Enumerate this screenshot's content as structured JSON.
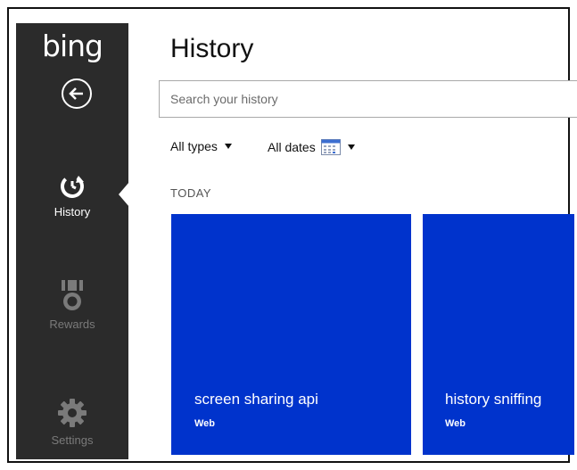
{
  "app": {
    "logo_text": "bing"
  },
  "sidebar": {
    "items": [
      {
        "label": "History",
        "icon": "history-icon",
        "active": true
      },
      {
        "label": "Rewards",
        "icon": "medal-icon",
        "active": false
      },
      {
        "label": "Settings",
        "icon": "gear-icon",
        "active": false
      }
    ]
  },
  "main": {
    "title": "History",
    "search": {
      "placeholder": "Search your history",
      "value": ""
    },
    "filters": {
      "types_label": "All types",
      "dates_label": "All dates"
    },
    "section_label": "TODAY",
    "tiles": [
      {
        "title": "screen sharing api",
        "type": "Web"
      },
      {
        "title": "history sniffing",
        "type": "Web"
      }
    ]
  },
  "colors": {
    "sidebar_bg": "#2b2b2b",
    "tile_bg": "#0033cc",
    "inactive_label": "#7a7a7a"
  }
}
